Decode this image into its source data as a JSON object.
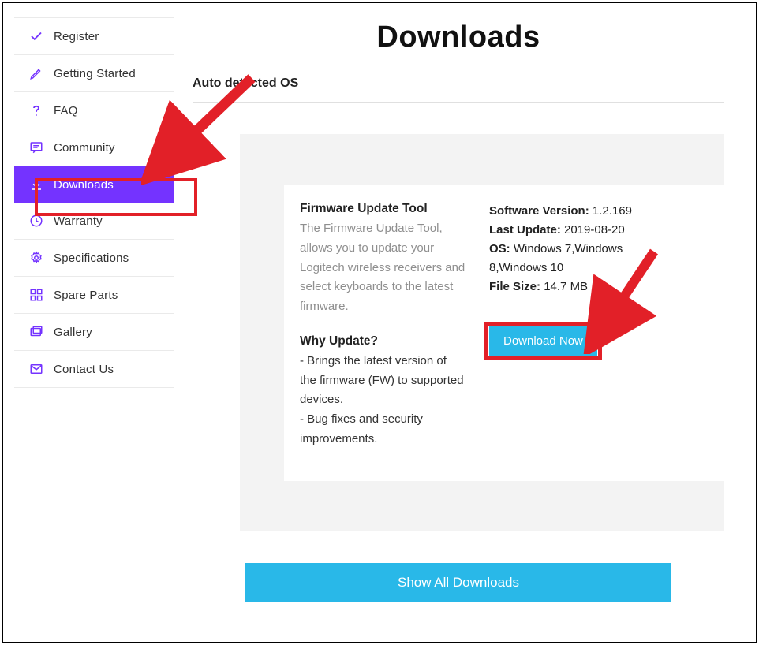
{
  "sidebar": {
    "items": [
      {
        "label": "Register"
      },
      {
        "label": "Getting Started"
      },
      {
        "label": "FAQ"
      },
      {
        "label": "Community"
      },
      {
        "label": "Downloads"
      },
      {
        "label": "Warranty"
      },
      {
        "label": "Specifications"
      },
      {
        "label": "Spare Parts"
      },
      {
        "label": "Gallery"
      },
      {
        "label": "Contact Us"
      }
    ]
  },
  "main": {
    "title": "Downloads",
    "subtitle": "Auto detected OS",
    "tool": {
      "title": "Firmware Update Tool",
      "description": "The Firmware Update Tool, allows you to update your Logitech wireless receivers and select keyboards to the latest firmware.",
      "why_title": "Why Update?",
      "why_line1": "- Brings the latest version of the firmware (FW) to supported devices.",
      "why_line2": "- Bug fixes and security improvements."
    },
    "meta": {
      "version_label": "Software Version:",
      "version_value": "1.2.169",
      "last_update_label": "Last Update:",
      "last_update_value": "2019-08-20",
      "os_label": "OS:",
      "os_value": "Windows 7,Windows 8,Windows 10",
      "filesize_label": "File Size:",
      "filesize_value": "14.7 MB"
    },
    "download_button": "Download Now",
    "show_all_button": "Show All Downloads"
  }
}
